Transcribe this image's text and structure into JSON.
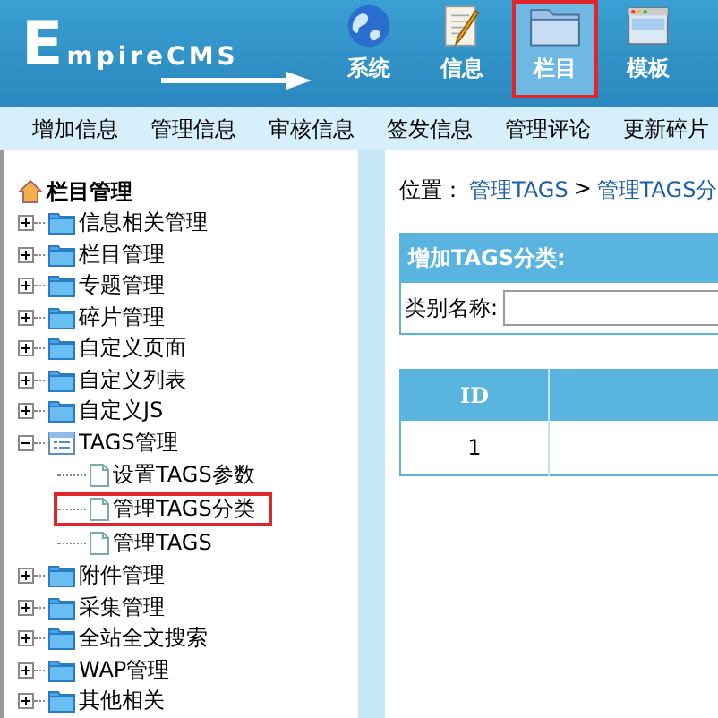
{
  "header": {
    "logo": "EmpireCMS",
    "nav": [
      {
        "label": "系统",
        "kind": "globe",
        "selected": false
      },
      {
        "label": "信息",
        "kind": "notepad",
        "selected": false
      },
      {
        "label": "栏目",
        "kind": "folder",
        "selected": true
      },
      {
        "label": "模板",
        "kind": "window",
        "selected": false
      }
    ]
  },
  "menu": [
    "增加信息",
    "管理信息",
    "审核信息",
    "签发信息",
    "管理评论",
    "更新碎片"
  ],
  "tree": {
    "label": "栏目管理",
    "children": [
      {
        "kind": "folder",
        "label": "信息相关管理",
        "expanded": false
      },
      {
        "kind": "folder",
        "label": "栏目管理",
        "expanded": false
      },
      {
        "kind": "folder",
        "label": "专题管理",
        "expanded": false
      },
      {
        "kind": "folder",
        "label": "碎片管理",
        "expanded": false
      },
      {
        "kind": "folder",
        "label": "自定义页面",
        "expanded": false
      },
      {
        "kind": "folder",
        "label": "自定义列表",
        "expanded": false
      },
      {
        "kind": "folder",
        "label": "自定义JS",
        "expanded": false
      },
      {
        "kind": "folder",
        "label": "TAGS管理",
        "expanded": true,
        "children": [
          {
            "kind": "page",
            "label": "设置TAGS参数",
            "selected": false
          },
          {
            "kind": "page",
            "label": "管理TAGS分类",
            "selected": true
          },
          {
            "kind": "page",
            "label": "管理TAGS",
            "selected": false
          }
        ]
      },
      {
        "kind": "folder",
        "label": "附件管理",
        "expanded": false
      },
      {
        "kind": "folder",
        "label": "采集管理",
        "expanded": false
      },
      {
        "kind": "folder",
        "label": "全站全文搜索",
        "expanded": false
      },
      {
        "kind": "folder",
        "label": "WAP管理",
        "expanded": false
      },
      {
        "kind": "folder",
        "label": "其他相关",
        "expanded": false
      }
    ]
  },
  "breadcrumb": {
    "label": "位置：",
    "links": [
      "管理TAGS",
      "管理TAGS分"
    ],
    "separator": ">"
  },
  "add_form": {
    "title": "增加TAGS分类:",
    "field_label": "类别名称:"
  },
  "table": {
    "columns": [
      "ID"
    ],
    "rows": [
      [
        "1"
      ]
    ]
  }
}
